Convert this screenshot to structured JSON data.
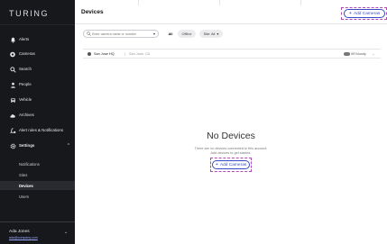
{
  "app": {
    "logo": "TURING"
  },
  "sidebar": {
    "items": [
      {
        "label": "Alerts",
        "icon": "bell-icon"
      },
      {
        "label": "Cameras",
        "icon": "camera-icon"
      },
      {
        "label": "Search",
        "icon": "search-icon"
      },
      {
        "label": "People",
        "icon": "person-icon"
      },
      {
        "label": "Vehicle",
        "icon": "car-icon"
      },
      {
        "label": "Archives",
        "icon": "cloud-icon"
      },
      {
        "label": "Alert rules & Notifications",
        "icon": "rules-icon"
      },
      {
        "label": "Settings",
        "icon": "gear-icon",
        "expanded": true
      }
    ],
    "settings_sub": [
      {
        "label": "Notifications"
      },
      {
        "label": "Sites"
      },
      {
        "label": "Devices",
        "active": true
      },
      {
        "label": "Users"
      }
    ],
    "user": {
      "name": "Ada Jones",
      "email": "ada@company.com"
    }
  },
  "header": {
    "title": "Devices",
    "add_button": "Add Cameras"
  },
  "filters": {
    "search_placeholder": "Enter camera name or number",
    "segments": [
      {
        "label": "All",
        "active": true
      },
      {
        "label": "Offline",
        "active": false
      }
    ],
    "site_filter": "Site: All"
  },
  "site_row": {
    "name": "San Jose HQ",
    "location": "San Jose, CA",
    "weather": "59°/cloudy"
  },
  "empty_state": {
    "title": "No Devices",
    "line1": "There are no devices connected to this account.",
    "line2": "Add devices to get started.",
    "button": "Add Cameras"
  },
  "colors": {
    "sidebar_bg": "#17181c",
    "accent": "#3b4bc7",
    "highlight_dash": "#b24bb0"
  }
}
